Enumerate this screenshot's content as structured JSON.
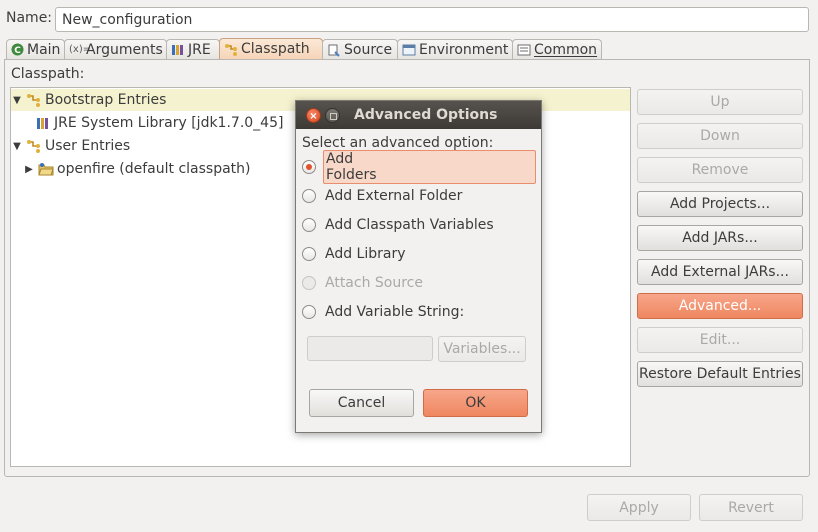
{
  "name_row": {
    "label": "Name:",
    "value": "New_configuration"
  },
  "tabs": [
    {
      "label": "Main",
      "icon": "main-icon"
    },
    {
      "label": "Arguments",
      "icon": "arguments-icon"
    },
    {
      "label": "JRE",
      "icon": "jre-icon"
    },
    {
      "label": "Classpath",
      "icon": "classpath-icon",
      "active": true
    },
    {
      "label": "Source",
      "icon": "source-icon"
    },
    {
      "label": "Environment",
      "icon": "environment-icon"
    },
    {
      "label": "Common",
      "icon": "common-icon"
    }
  ],
  "classpath": {
    "label": "Classpath:",
    "tree": [
      {
        "label": "Bootstrap Entries",
        "icon": "classpath-entries-icon",
        "expanded": true
      },
      {
        "label": "JRE System Library [jdk1.7.0_45]",
        "icon": "library-icon"
      },
      {
        "label": "User Entries",
        "icon": "classpath-entries-icon",
        "expanded": true
      },
      {
        "label": "openfire (default classpath)",
        "icon": "project-folder-icon",
        "expanded": false
      }
    ]
  },
  "side_buttons": {
    "up": "Up",
    "down": "Down",
    "remove": "Remove",
    "add_projects": "Add Projects...",
    "add_jars": "Add JARs...",
    "add_external_jars": "Add External JARs...",
    "advanced": "Advanced...",
    "edit": "Edit...",
    "restore": "Restore Default Entries"
  },
  "bottom_buttons": {
    "apply": "Apply",
    "revert": "Revert"
  },
  "dialog": {
    "title": "Advanced Options",
    "prompt": "Select an advanced option:",
    "options": [
      {
        "label": "Add Folders",
        "checked": true
      },
      {
        "label": "Add External Folder"
      },
      {
        "label": "Add Classpath Variables"
      },
      {
        "label": "Add Library"
      },
      {
        "label": "Attach Source",
        "disabled": true
      },
      {
        "label": "Add Variable String:"
      }
    ],
    "variable_value": "",
    "variables_button": "Variables...",
    "cancel": "Cancel",
    "ok": "OK"
  },
  "colors": {
    "accent": "#ef8760",
    "selection": "#f5f2cf",
    "titlebar": "#3d3a36",
    "radio_checked": "#e0532c"
  }
}
